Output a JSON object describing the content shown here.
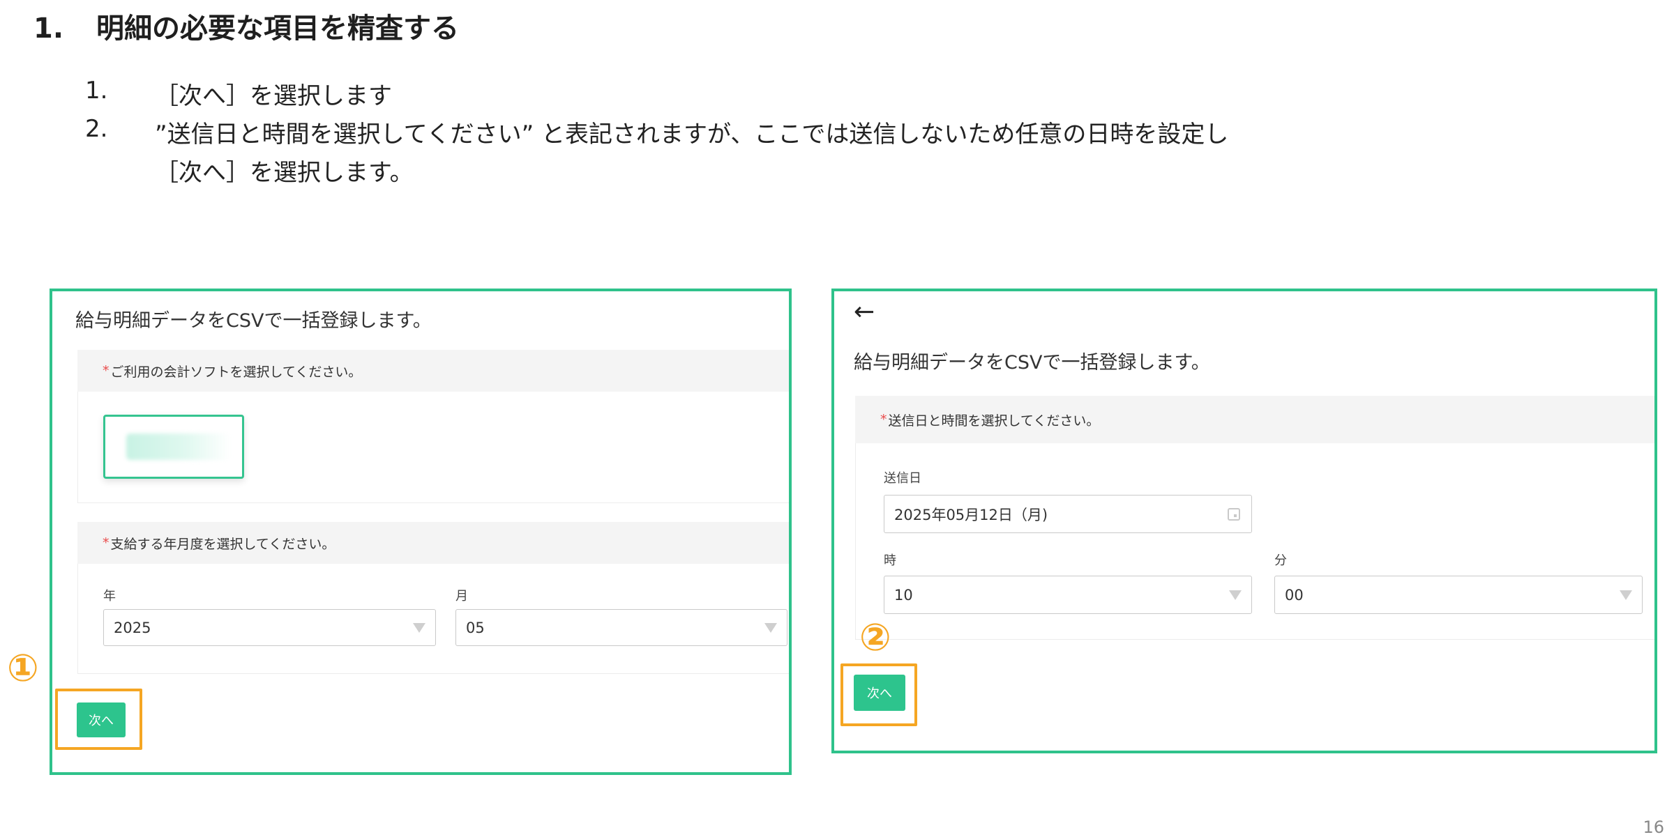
{
  "slide": {
    "title_number": "1.",
    "title_text": "明細の必要な項目を精査する",
    "steps": [
      {
        "n": "1.",
        "text": "［次へ］を選択します"
      },
      {
        "n": "2.",
        "text": "”送信日と時間を選択してください” と表記されますが、ここでは送信しないため任意の日時を設定し"
      }
    ],
    "step2_continuation": "［次へ］を選択します。",
    "page_number": "16"
  },
  "panel1": {
    "title": "給与明細データをCSVで一括登録します。",
    "section_software": {
      "required_mark": "*",
      "label": "ご利用の会計ソフトを選択してください。"
    },
    "section_period": {
      "required_mark": "*",
      "label": "支給する年月度を選択してください。"
    },
    "year": {
      "label": "年",
      "value": "2025"
    },
    "month": {
      "label": "月",
      "value": "05"
    },
    "next_button": "次へ",
    "marker": "①"
  },
  "panel2": {
    "back_icon": "back-arrow-icon",
    "back_glyph": "←",
    "title": "給与明細データをCSVで一括登録します。",
    "section_send": {
      "required_mark": "*",
      "label": "送信日と時間を選択してください。"
    },
    "send_date": {
      "label": "送信日",
      "value": "2025年05月12日（月)"
    },
    "hour": {
      "label": "時",
      "value": "10"
    },
    "minute": {
      "label": "分",
      "value": "00"
    },
    "next_button": "次へ",
    "marker": "②"
  },
  "colors": {
    "frame_border": "#2fc28b",
    "button_green": "#2dc48d",
    "highlight_orange": "#f5a623",
    "required_red": "#e94b4b"
  }
}
